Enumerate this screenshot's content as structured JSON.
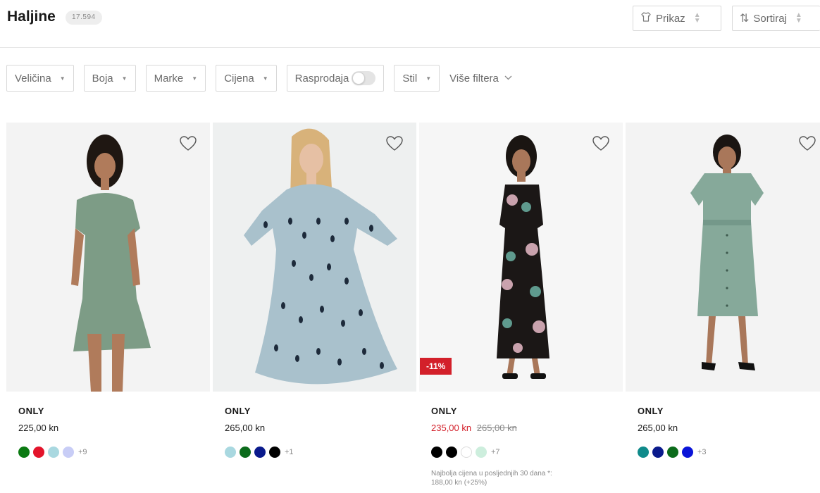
{
  "header": {
    "title": "Haljine",
    "count": "17.594",
    "view_button": {
      "label": "Prikaz",
      "icon": "shirt-icon"
    },
    "sort_button": {
      "label": "Sortiraj",
      "icon": "sort-arrows-icon"
    }
  },
  "filters": {
    "size": "Veličina",
    "color": "Boja",
    "brands": "Marke",
    "price": "Cijena",
    "sale": "Rasprodaja",
    "sale_toggle_on": false,
    "style": "Stil",
    "more": "Više filtera"
  },
  "colors": {
    "accent_red": "#d3202a",
    "text": "#1a1a1a",
    "muted": "#8a8a8a"
  },
  "products": [
    {
      "brand": "ONLY",
      "price": "225,00 kn",
      "old_price": "",
      "discount": "",
      "swatches": [
        "#0b7a12",
        "#e3142b",
        "#a9d8e0",
        "#c8cdf6"
      ],
      "more_colors": "+9",
      "note": ""
    },
    {
      "brand": "ONLY",
      "price": "265,00 kn",
      "old_price": "",
      "discount": "",
      "swatches": [
        "#a9d8e0",
        "#0b6b1b",
        "#0a1a8c",
        "#000000"
      ],
      "more_colors": "+1",
      "note": ""
    },
    {
      "brand": "ONLY",
      "price": "235,00 kn",
      "old_price": "265,00 kn",
      "discount": "-11%",
      "swatches": [
        "#000000",
        "#000000",
        "#ffffff",
        "#cdeedd"
      ],
      "more_colors": "+7",
      "note_line1": "Najbolja cijena u posljednjih 30 dana *:",
      "note_line2": "188,00 kn (+25%)"
    },
    {
      "brand": "ONLY",
      "price": "265,00 kn",
      "old_price": "",
      "discount": "",
      "swatches": [
        "#0f8a8a",
        "#0a1a8c",
        "#0b6b1b",
        "#0a14d8"
      ],
      "more_colors": "+3",
      "note": ""
    }
  ]
}
